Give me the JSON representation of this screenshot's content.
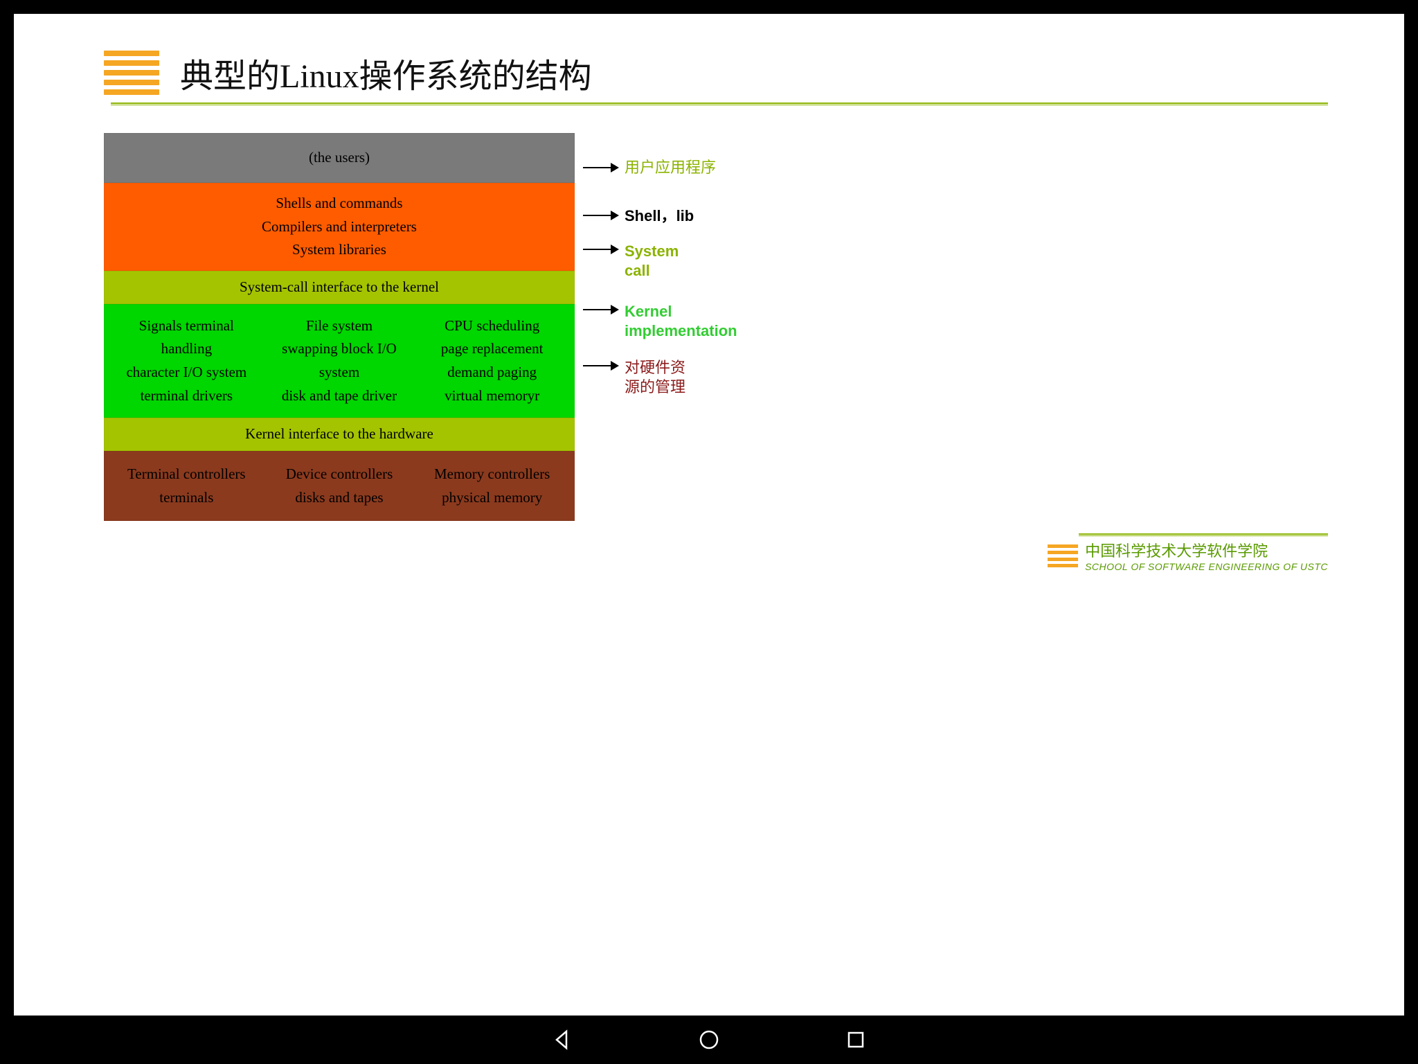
{
  "title": "典型的Linux操作系统的结构",
  "layers": {
    "users": "(the users)",
    "shells": {
      "line1": "Shells and commands",
      "line2": "Compilers and interpreters",
      "line3": "System libraries"
    },
    "syscall": "System-call interface to the kernel",
    "kernel": {
      "col1": {
        "l1": "Signals terminal",
        "l2": "handling",
        "l3": "character I/O system",
        "l4": "terminal    drivers"
      },
      "col2": {
        "l1": "File system",
        "l2": "swapping block I/O",
        "l3": "system",
        "l4": "disk and tape driver"
      },
      "col3": {
        "l1": "CPU scheduling",
        "l2": "page replacement",
        "l3": "demand paging",
        "l4": "virtual memoryr"
      }
    },
    "khw": "Kernel interface to the hardware",
    "hw": {
      "col1": {
        "l1": "Terminal controllers",
        "l2": "terminals"
      },
      "col2": {
        "l1": "Device controllers",
        "l2": "disks and tapes"
      },
      "col3": {
        "l1": "Memory controllers",
        "l2": "physical memory"
      }
    }
  },
  "annotations": {
    "users": "用户应用程序",
    "shells": "Shell，lib",
    "syscall_l1": "System",
    "syscall_l2": "call",
    "kernel_l1": "Kernel",
    "kernel_l2": "implementation",
    "khw_l1": "对硬件资",
    "khw_l2": "源的管理"
  },
  "footer": {
    "cn": "中国科学技术大学软件学院",
    "en": "SCHOOL OF SOFTWARE ENGINEERING OF USTC"
  }
}
